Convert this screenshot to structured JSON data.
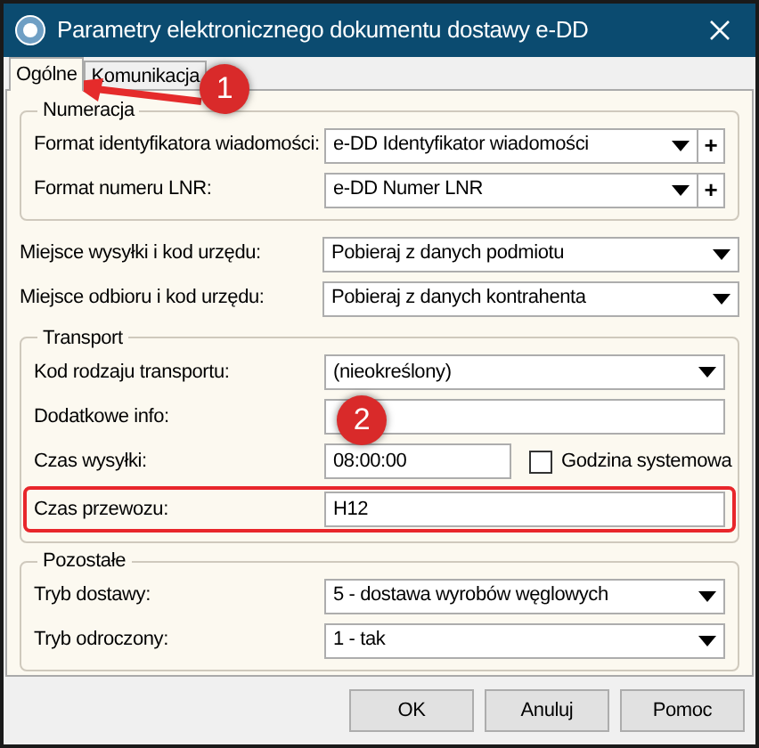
{
  "window": {
    "title": "Parametry elektronicznego dokumentu dostawy e-DD"
  },
  "tabs": [
    {
      "label": "Ogólne",
      "selected": true
    },
    {
      "label": "Komunikacja",
      "selected": false
    }
  ],
  "sections": [
    {
      "kind": "group",
      "title": "Numeracja",
      "rows": [
        {
          "kind": "dropdown",
          "label": "Format identyfikatora wiadomości:",
          "value": "e-DD Identyfikator wiadomości",
          "add_button": "+",
          "highlighted": false
        },
        {
          "kind": "dropdown",
          "label": "Format numeru LNR:",
          "value": "e-DD Numer LNR",
          "add_button": "+",
          "highlighted": false
        }
      ]
    },
    {
      "kind": "plain",
      "rows": [
        {
          "kind": "dropdown",
          "label": "Miejsce wysyłki i kod urzędu:",
          "value": "Pobieraj z danych podmiotu",
          "highlighted": false
        },
        {
          "kind": "dropdown",
          "label": "Miejsce odbioru i kod urzędu:",
          "value": "Pobieraj z danych kontrahenta",
          "highlighted": false
        }
      ]
    },
    {
      "kind": "group",
      "title": "Transport",
      "rows": [
        {
          "kind": "dropdown",
          "label": "Kod rodzaju transportu:",
          "value": "(nieokreślony)",
          "highlighted": false
        },
        {
          "kind": "text",
          "label": "Dodatkowe info:",
          "highlighted": false
        },
        {
          "kind": "text",
          "label": "Czas wysyłki:",
          "value": "08:00:00",
          "checkbox": {
            "label": "Godzina systemowa",
            "checked": false
          },
          "highlighted": false
        },
        {
          "kind": "text",
          "label": "Czas przewozu:",
          "value": "H12",
          "highlighted": true
        }
      ]
    },
    {
      "kind": "group",
      "title": "Pozostałe",
      "rows": [
        {
          "kind": "dropdown",
          "label": "Tryb dostawy:",
          "value": "5 - dostawa wyrobów węglowych",
          "highlighted": false
        },
        {
          "kind": "dropdown",
          "label": "Tryb odroczony:",
          "value": "1 - tak",
          "highlighted": false
        }
      ]
    }
  ],
  "buttons": [
    "OK",
    "Anuluj",
    "Pomoc"
  ],
  "annotations": [
    {
      "label": "1"
    },
    {
      "label": "2"
    }
  ]
}
